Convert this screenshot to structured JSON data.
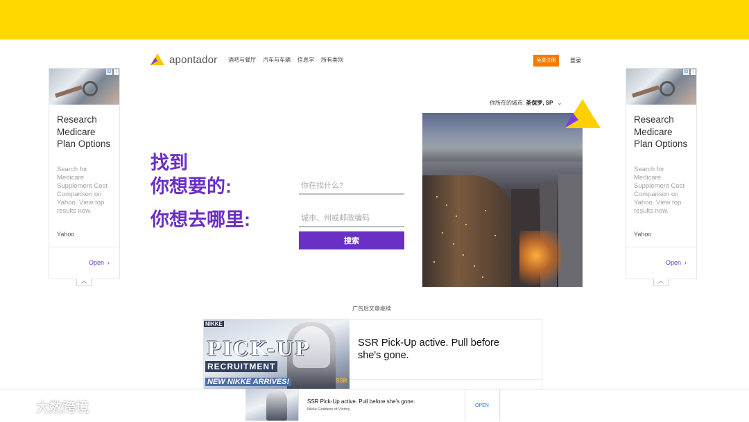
{
  "header": {
    "logo_text": "apontador",
    "nav": [
      "酒吧与餐厅",
      "汽车与车辆",
      "信息学",
      "所有类别"
    ],
    "register_label": "免费注册",
    "login_label": "登录",
    "brand_colors": {
      "purple": "#6a2fc4",
      "yellow": "#FFD800",
      "orange": "#F47B00"
    }
  },
  "city_selector": {
    "label": "你所在的城市:",
    "value": "圣保罗, SP",
    "icon": "chevron-down-icon"
  },
  "hero": {
    "headline_1": "找到",
    "headline_2": "你想要的:",
    "headline_3": "你想去哪里:",
    "what_placeholder": "你在找什么?",
    "where_placeholder": "城市、州或邮政编码",
    "search_label": "搜索"
  },
  "side_ad_left": {
    "title": "Research Medicare Plan Options",
    "description": "Search for Medicare Supplement Cost Comparison on Yahoo. View top results now.",
    "source": "Yahoo",
    "cta": "Open",
    "badge": "ID"
  },
  "side_ad_right": {
    "title": "Research Medicare Plan Options",
    "description": "Search for Medicare Supplement Cost Comparison on Yahoo. View top results now.",
    "source": "Yahoo",
    "cta": "Open",
    "badge": "ID"
  },
  "ad_label": "广告后文章继续",
  "native_ad": {
    "image_text_1": "PICK-UP",
    "image_text_2": "RECRUITMENT",
    "image_text_3": "NEW NIKKE ARRIVES!",
    "image_text_4": "NIKKE",
    "image_text_5": "SSR",
    "text": "SSR Pick-Up active. Pull before she's gone."
  },
  "sticky_ad": {
    "title": "SSR Pick-Up active. Pull before she's gone.",
    "subtitle": "Nikke Goddess of Victory",
    "cta": "OPEN"
  },
  "watermark": {
    "text": "大数跨境"
  }
}
